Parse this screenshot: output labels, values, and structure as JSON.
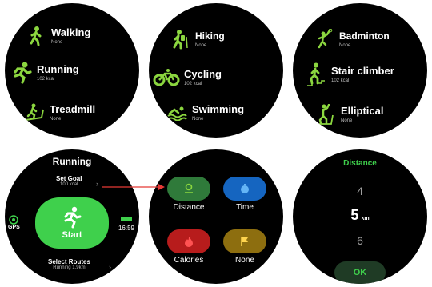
{
  "list1": [
    {
      "name": "Walking",
      "sub": "None",
      "icon": "walking-icon"
    },
    {
      "name": "Running",
      "sub": "102 kcal",
      "icon": "running-icon"
    },
    {
      "name": "Treadmill",
      "sub": "None",
      "icon": "treadmill-icon"
    }
  ],
  "list2": [
    {
      "name": "Hiking",
      "sub": "None",
      "icon": "hiking-icon"
    },
    {
      "name": "Cycling",
      "sub": "102 kcal",
      "icon": "cycling-icon"
    },
    {
      "name": "Swimming",
      "sub": "None",
      "icon": "swimming-icon"
    }
  ],
  "list3": [
    {
      "name": "Badminton",
      "sub": "None",
      "icon": "badminton-icon"
    },
    {
      "name": "Stair climber",
      "sub": "102 kcal",
      "icon": "stair-climber-icon"
    },
    {
      "name": "Elliptical",
      "sub": "None",
      "icon": "elliptical-icon"
    }
  ],
  "run_screen": {
    "title": "Running",
    "set_goal": "Set Goal",
    "goal_value": "100 kcal",
    "start": "Start",
    "gps": "GPS",
    "time": "16:59",
    "select_routes": "Select Routes",
    "route_value": "Running 1.9km"
  },
  "goal_picker": {
    "distance": "Distance",
    "time": "Time",
    "calories": "Calories",
    "none": "None"
  },
  "distance_picker": {
    "title": "Distance",
    "prev": "4",
    "current": "5",
    "unit": "km",
    "next": "6",
    "ok": "OK"
  },
  "colors": {
    "accent_green": "#3fd04c",
    "icon_green": "#8bd63f",
    "distance_pill": "#2f7a3a",
    "time_pill": "#1565c0",
    "calories_pill": "#b71c1c",
    "none_pill": "#8d6e0f",
    "arrow_red": "#e53935"
  }
}
